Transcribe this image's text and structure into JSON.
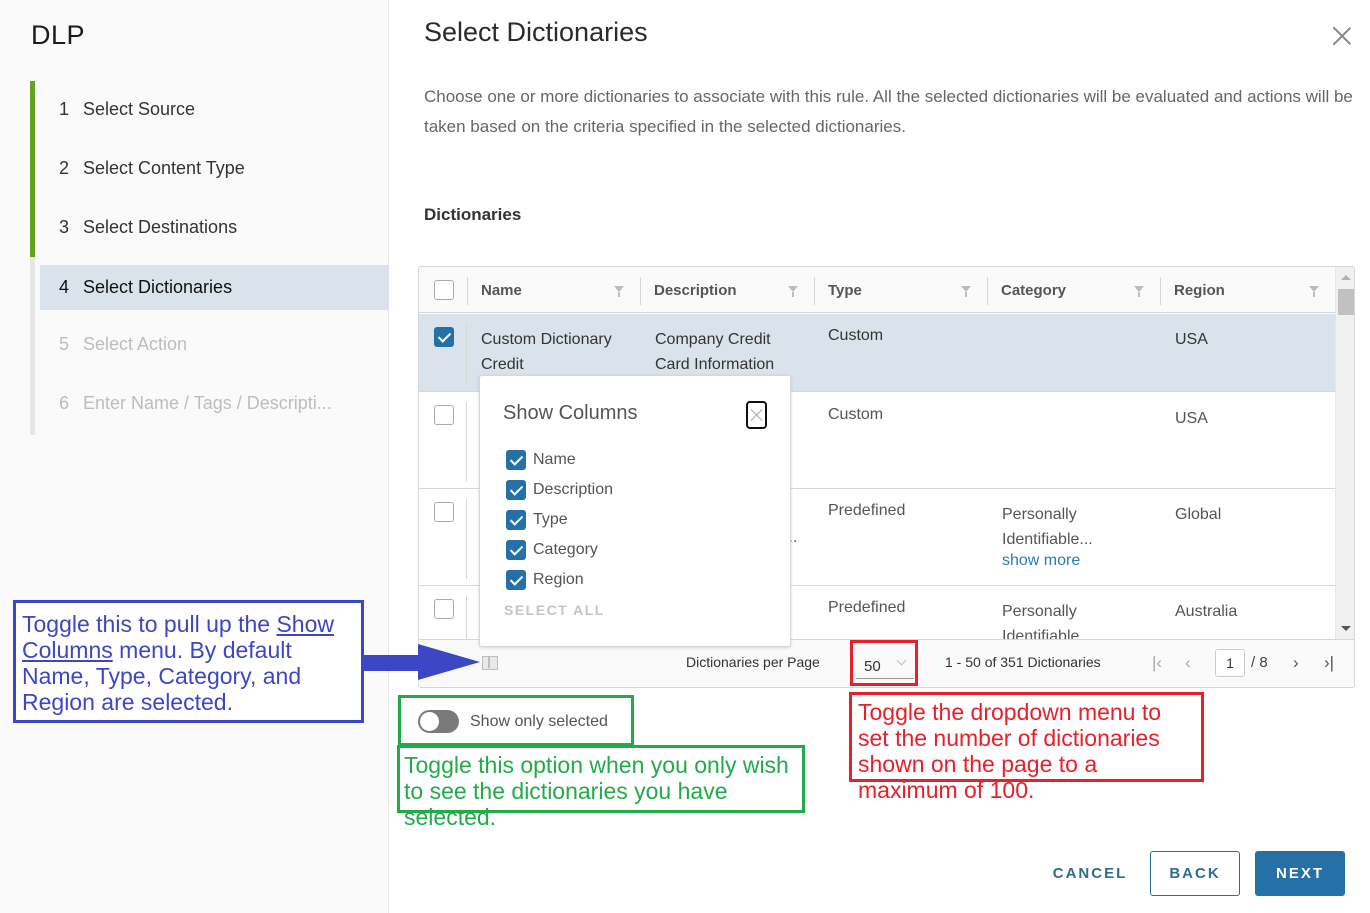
{
  "sidebar": {
    "app_title": "DLP",
    "steps": [
      {
        "num": "1",
        "label": "Select Source",
        "state": "done"
      },
      {
        "num": "2",
        "label": "Select Content Type",
        "state": "done"
      },
      {
        "num": "3",
        "label": "Select Destinations",
        "state": "done"
      },
      {
        "num": "4",
        "label": "Select Dictionaries",
        "state": "active"
      },
      {
        "num": "5",
        "label": "Select Action",
        "state": "disabled"
      },
      {
        "num": "6",
        "label": "Enter Name / Tags / Descripti...",
        "state": "disabled"
      }
    ]
  },
  "main": {
    "title": "Select Dictionaries",
    "intro": "Choose one or more dictionaries to associate with this rule. All the selected dictionaries will be evaluated and actions will be taken based on the criteria specified in the selected dictionaries.",
    "section_label": "Dictionaries"
  },
  "grid": {
    "columns": [
      "Name",
      "Description",
      "Type",
      "Category",
      "Region"
    ],
    "rows": [
      {
        "selected": true,
        "name": "Custom Dictionary Credit",
        "description": "Company Credit Card Information",
        "type": "Custom",
        "category": "",
        "category_more": "",
        "region": "USA"
      },
      {
        "selected": false,
        "name": "",
        "description": "",
        "type": "Custom",
        "category": "",
        "category_more": "",
        "region": "USA"
      },
      {
        "selected": false,
        "name": "",
        "description": "...",
        "type": "Predefined",
        "category": "Personally Identifiable...",
        "category_more": "show more",
        "region": "Global"
      },
      {
        "selected": false,
        "name": "",
        "description": "",
        "type": "Predefined",
        "category": "Personally Identifiable",
        "category_more": "",
        "region": "Australia"
      }
    ],
    "footer": {
      "per_page_label": "Dictionaries per Page",
      "per_page_value": "50",
      "range_text": "1 - 50 of 351 Dictionaries",
      "current_page": "1",
      "total_pages": "/ 8"
    }
  },
  "show_columns": {
    "title": "Show Columns",
    "options": [
      {
        "label": "Name",
        "checked": true
      },
      {
        "label": "Description",
        "checked": true
      },
      {
        "label": "Type",
        "checked": true
      },
      {
        "label": "Category",
        "checked": true
      },
      {
        "label": "Region",
        "checked": true
      }
    ],
    "select_all_label": "SELECT ALL"
  },
  "toggle": {
    "label": "Show only selected",
    "on": false
  },
  "buttons": {
    "cancel": "CANCEL",
    "back": "BACK",
    "next": "NEXT"
  },
  "annotations": {
    "blue_pre": "Toggle this to pull up the ",
    "blue_link": "Show Columns",
    "blue_post": " menu. By default Name, Type, Category, and Region are selected.",
    "green": "Toggle this option when you only wish to see the dictionaries you have selected.",
    "red": "Toggle the dropdown menu to set the number of dictionaries shown on the page to a maximum of 100.",
    "colors": {
      "blue": "#3d46c5",
      "green": "#22ab4a",
      "red": "#e8202a"
    }
  },
  "colors": {
    "accent": "#2470a7",
    "progress_green": "#62a420",
    "active_step_bg": "#dae3eb",
    "link": "#2d7bb6"
  }
}
